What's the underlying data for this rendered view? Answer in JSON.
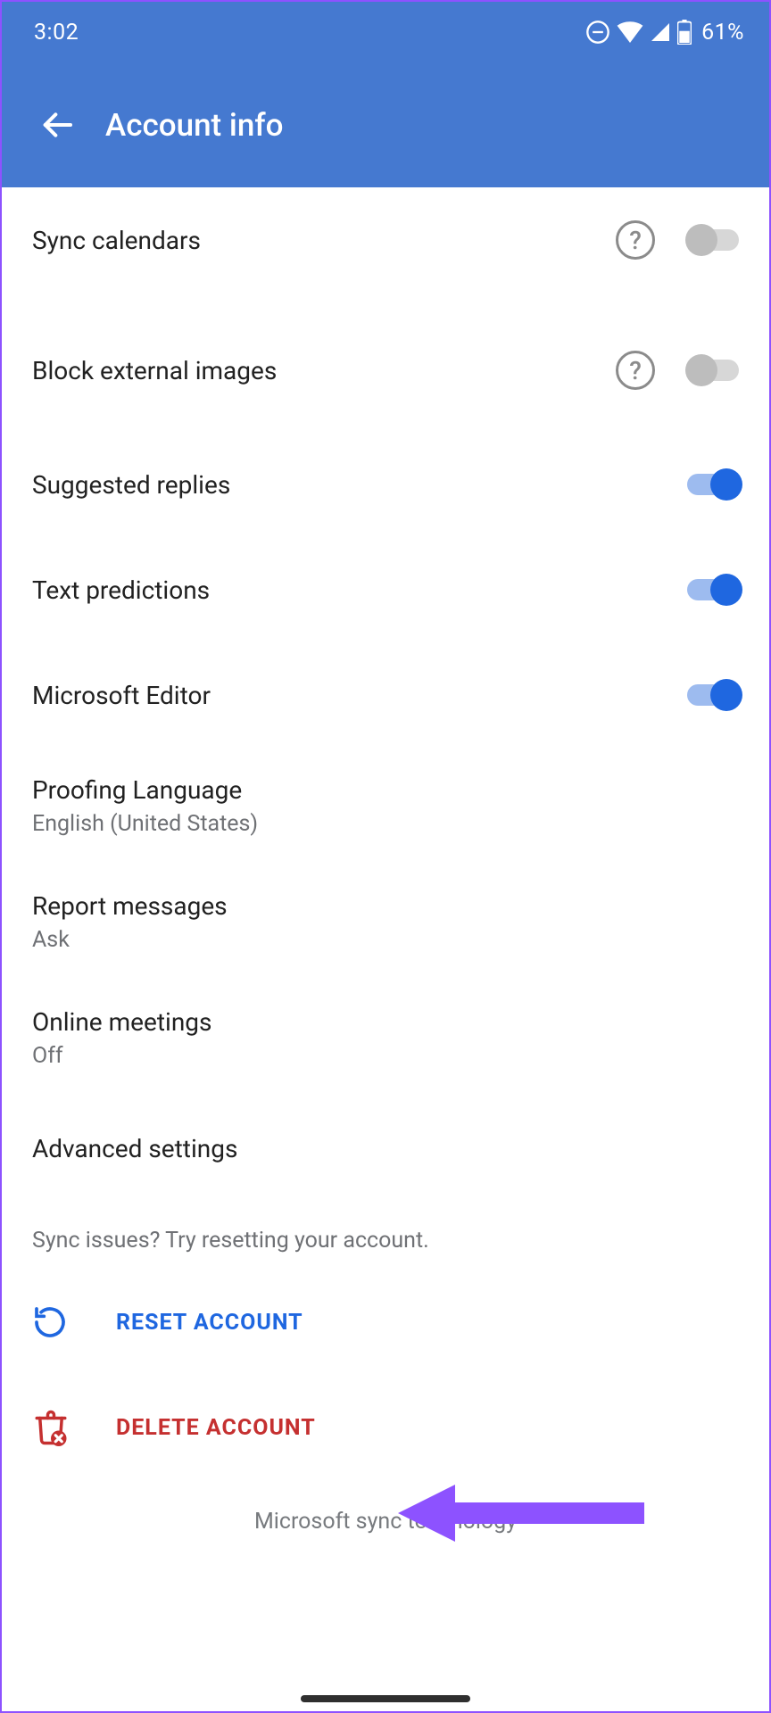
{
  "status": {
    "time": "3:02",
    "battery": "61%"
  },
  "header": {
    "title": "Account info"
  },
  "settings": {
    "sync_calendars": {
      "label": "Sync calendars",
      "on": false,
      "help": true
    },
    "block_external_images": {
      "label": "Block external images",
      "on": false,
      "help": true
    },
    "suggested_replies": {
      "label": "Suggested replies",
      "on": true
    },
    "text_predictions": {
      "label": "Text predictions",
      "on": true
    },
    "microsoft_editor": {
      "label": "Microsoft Editor",
      "on": true
    },
    "proofing_language": {
      "label": "Proofing Language",
      "value": "English (United States)"
    },
    "report_messages": {
      "label": "Report messages",
      "value": "Ask"
    },
    "online_meetings": {
      "label": "Online meetings",
      "value": "Off"
    },
    "advanced_settings": {
      "label": "Advanced settings"
    }
  },
  "hint": "Sync issues? Try resetting your account.",
  "actions": {
    "reset": "RESET ACCOUNT",
    "delete": "DELETE ACCOUNT"
  },
  "footer": "Microsoft sync technology",
  "colors": {
    "primary": "#4579d0",
    "accent_toggle": "#1f67e0",
    "danger": "#c53030",
    "arrow": "#8d52ff"
  }
}
